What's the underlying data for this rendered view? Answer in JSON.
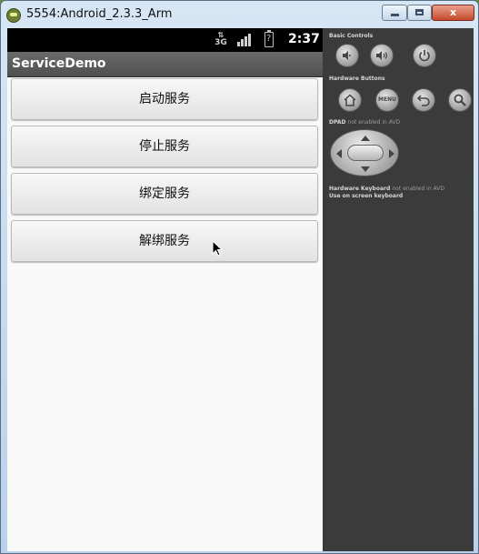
{
  "window": {
    "title": "5554:Android_2.3.3_Arm",
    "min_label": "",
    "max_label": "",
    "close_label": "x"
  },
  "statusbar": {
    "network": "3G",
    "time": "2:37"
  },
  "app": {
    "title": "ServiceDemo",
    "buttons": [
      {
        "label": "启动服务"
      },
      {
        "label": "停止服务"
      },
      {
        "label": "绑定服务"
      },
      {
        "label": "解绑服务"
      }
    ]
  },
  "panel": {
    "basic_controls": "Basic Controls",
    "hardware_buttons": "Hardware Buttons",
    "menu_label": "MENU",
    "dpad_title": "DPAD",
    "dpad_note": "not enabled in AVD",
    "keyboard_title": "Hardware Keyboard",
    "keyboard_note": "not enabled in AVD",
    "keyboard_hint": "Use on screen keyboard",
    "controls": [
      "volume-down",
      "volume-up",
      "power"
    ],
    "hardware": [
      "home",
      "menu",
      "back",
      "search"
    ]
  }
}
